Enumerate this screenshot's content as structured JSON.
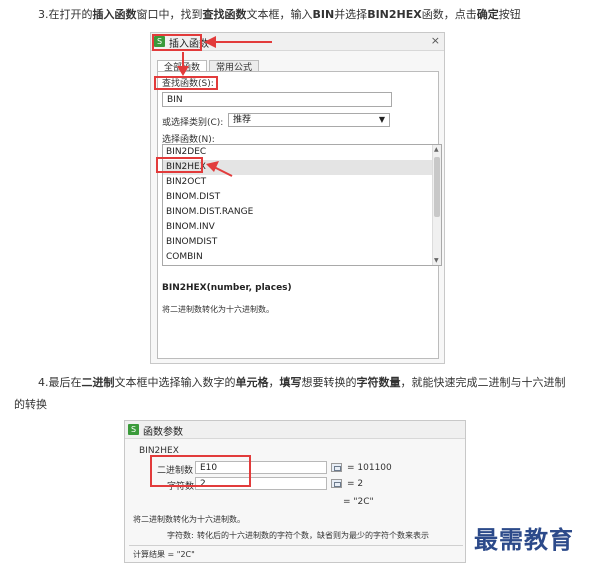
{
  "step3": {
    "p1": "3.在打开的",
    "b1": "插入函数",
    "p2": "窗口中，找到",
    "b2": "查找函数",
    "p3": "文本框，输入",
    "b3": "BIN",
    "p4": "并选择",
    "b4": "BIN2HEX",
    "p5": "函数，点击",
    "b5": "确定",
    "p6": "按钮"
  },
  "dialog1": {
    "title": "插入函数",
    "close_glyph": "×",
    "tabs": [
      "全部函数",
      "常用公式"
    ],
    "search_label": "查找函数(S):",
    "search_value": "BIN",
    "category_label": "或选择类别(C):",
    "category_value": "推荐",
    "list_label": "选择函数(N):",
    "functions": [
      "BIN2DEC",
      "BIN2HEX",
      "BIN2OCT",
      "BINOM.DIST",
      "BINOM.DIST.RANGE",
      "BINOM.INV",
      "BINOMDIST",
      "COMBIN"
    ],
    "selected_index": 1,
    "signature": "BIN2HEX(number, places)",
    "description": "将二进制数转化为十六进制数。"
  },
  "step4": {
    "p1": "4.最后在",
    "b1": "二进制",
    "p2": "文本框中选择输入数字的",
    "b2": "单元格",
    "p3": "，",
    "b3": "填写",
    "p4": "想要转换的",
    "b4": "字符数量",
    "p5": "，就能快速完成二进制与十六进制",
    "line2": "的转换"
  },
  "dialog2": {
    "title": "函数参数",
    "func_name": "BIN2HEX",
    "field1_label": "二进制数",
    "field1_value": "E10",
    "field1_result": "= 101100",
    "field2_label": "字符数",
    "field2_value": "2",
    "field2_result": "= 2",
    "formula_result": "= \"2C\"",
    "description": "将二进制数转化为十六进制数。",
    "param_label": "字符数:",
    "param_desc": "转化后的十六进制数的字符个数，缺省则为最少的字符个数来表示",
    "calc_result": "计算结果 = \"2C\""
  },
  "watermark": "最需教育",
  "colors": {
    "highlight": "#e23b3b",
    "watermark": "#2c4a8a"
  }
}
